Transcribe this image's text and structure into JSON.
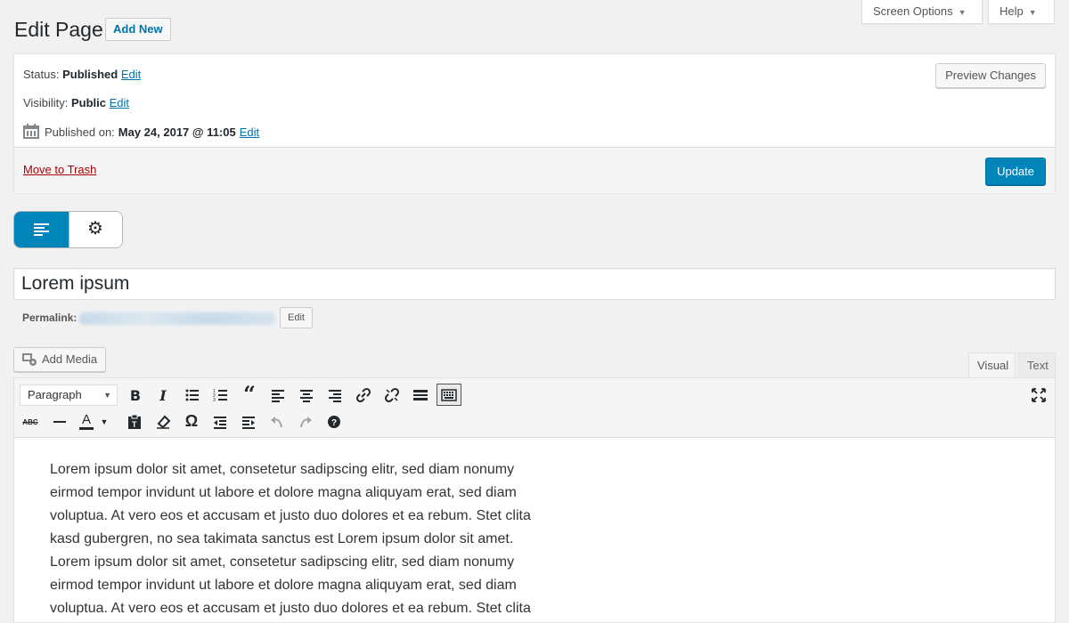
{
  "header": {
    "page_title": "Edit Page",
    "add_new": "Add New",
    "screen_options": "Screen Options",
    "help": "Help"
  },
  "publish": {
    "status_label": "Status:",
    "status_value": "Published",
    "visibility_label": "Visibility:",
    "visibility_value": "Public",
    "published_on_label": "Published on:",
    "published_on_value": "May 24, 2017 @ 11:05",
    "edit_label": "Edit",
    "preview_changes": "Preview Changes",
    "move_to_trash": "Move to Trash",
    "update": "Update"
  },
  "mode_toggle": {
    "left_icon": "editor-lines-icon",
    "right_icon": "gear-icon",
    "active": "editor",
    "active_color": "#0085ba"
  },
  "post": {
    "title": "Lorem ipsum",
    "permalink_label": "Permalink:",
    "permalink_edit": "Edit"
  },
  "editor": {
    "add_media": "Add Media",
    "tab_visual": "Visual",
    "tab_text": "Text",
    "format_select": "Paragraph",
    "content_lines": [
      "Lorem ipsum dolor sit amet, consetetur sadipscing elitr, sed diam nonumy",
      "eirmod tempor invidunt ut labore et dolore magna aliquyam erat, sed diam",
      "voluptua. At vero eos et accusam et justo duo dolores et ea rebum. Stet clita",
      "kasd gubergren, no sea takimata sanctus est Lorem ipsum dolor sit amet.",
      "Lorem ipsum dolor sit amet, consetetur sadipscing elitr, sed diam nonumy",
      "eirmod tempor invidunt ut labore et dolore magna aliquyam erat, sed diam",
      "voluptua. At vero eos et accusam et justo duo dolores et ea rebum. Stet clita"
    ]
  },
  "colors": {
    "primary_button": "#0085ba",
    "link": "#0073aa",
    "trash": "#a00"
  }
}
